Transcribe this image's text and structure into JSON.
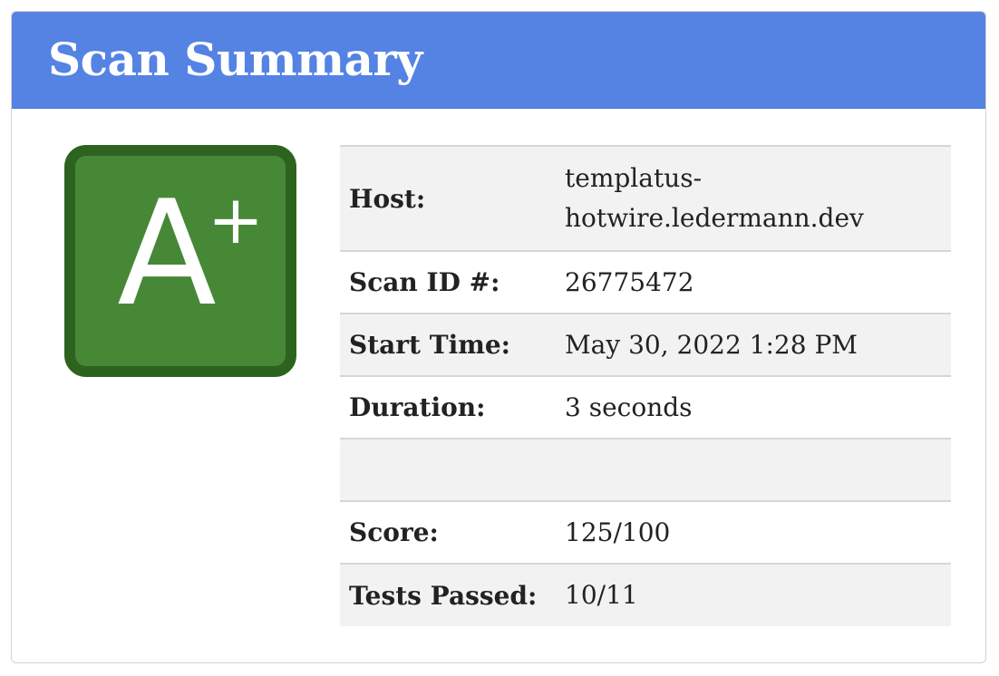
{
  "header": {
    "title": "Scan Summary"
  },
  "grade": {
    "letter": "A",
    "modifier": "+"
  },
  "summary": {
    "host_label": "Host:",
    "host_value_line1": "templatus-",
    "host_value_line2": "hotwire.ledermann.dev",
    "scan_id_label": "Scan ID #:",
    "scan_id_value": "26775472",
    "start_time_label": "Start Time:",
    "start_time_value": "May 30, 2022 1:28 PM",
    "duration_label": "Duration:",
    "duration_value": "3 seconds",
    "score_label": "Score:",
    "score_value": "125/100",
    "tests_passed_label": "Tests Passed:",
    "tests_passed_value": "10/11"
  },
  "colors": {
    "header_bg": "#5483e4",
    "grade_bg": "#478837",
    "grade_border": "#2d631f",
    "row_shade": "#f2f2f2"
  }
}
